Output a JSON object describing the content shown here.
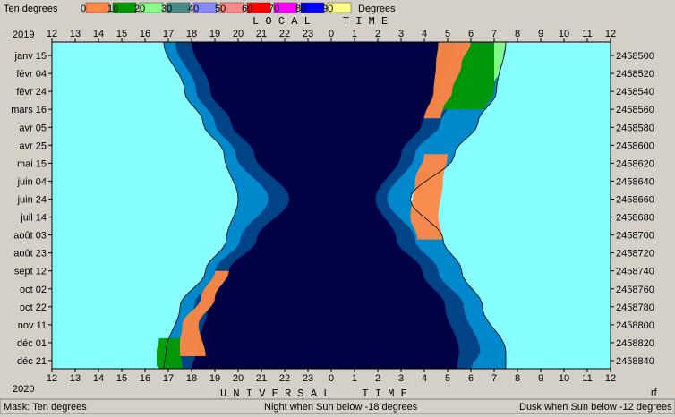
{
  "header": {
    "mask_label": "Ten degrees",
    "units_label": "Degrees",
    "year_top": "2019",
    "year_bottom": "2020",
    "local_time_label": "L O C A L     T I M E",
    "universal_time_label": "U N I V E R S A L     T I M E",
    "corner_mark": "rf"
  },
  "legend": {
    "labels": [
      "0",
      "10",
      "20",
      "30",
      "40",
      "50",
      "60",
      "70",
      "80",
      "90"
    ],
    "colors": [
      "#ff8844",
      "#009900",
      "#88ff88",
      "#448888",
      "#8888ff",
      "#ff8888",
      "#ff0000",
      "#ff00ff",
      "#0000ff",
      "#ffff88"
    ]
  },
  "status_bar": {
    "mask": "Mask:  Ten degrees",
    "night": "Night when Sun below -18 degrees",
    "dusk": "Dusk when Sun below -12 degrees"
  },
  "chart_data": {
    "type": "area",
    "local_time_ticks": [
      "12",
      "13",
      "14",
      "15",
      "16",
      "17",
      "18",
      "19",
      "20",
      "21",
      "22",
      "23",
      "0",
      "1",
      "2",
      "3",
      "4",
      "5",
      "6",
      "7",
      "8",
      "9",
      "10",
      "11",
      "12"
    ],
    "universal_time_ticks": [
      "12",
      "13",
      "14",
      "15",
      "16",
      "17",
      "18",
      "19",
      "20",
      "21",
      "22",
      "23",
      "0",
      "1",
      "2",
      "3",
      "4",
      "5",
      "6",
      "7",
      "8",
      "9",
      "10",
      "11",
      "12"
    ],
    "date_labels": [
      "janv 15",
      "févr 04",
      "févr 24",
      "mars 16",
      "avr 05",
      "avr 25",
      "mai 15",
      "juin 04",
      "juin 24",
      "juil 14",
      "août 03",
      "août 23",
      "sept 12",
      "oct 02",
      "oct 22",
      "nov 11",
      "déc 01",
      "déc 21"
    ],
    "jd_labels": [
      "2458500",
      "2458520",
      "2458540",
      "2458560",
      "2458580",
      "2458600",
      "2458620",
      "2458640",
      "2458660",
      "2458680",
      "2458700",
      "2458720",
      "2458740",
      "2458760",
      "2458780",
      "2458800",
      "2458820",
      "2458840"
    ],
    "jd_range": [
      2458485,
      2458849
    ],
    "time_range_hours": [
      12,
      36
    ],
    "colors": {
      "day": "#88ffff",
      "twilight_outer": "#0088cc",
      "twilight_inner": "#004488",
      "night": "#000044",
      "moon_low": "#ff8844",
      "moon_mid": "#009900",
      "moon_high": "#88ff88"
    },
    "boundaries": {
      "jd": [
        2458485,
        2458540,
        2458575,
        2458610,
        2458660,
        2458705,
        2458740,
        2458780,
        2458830,
        2458849
      ],
      "sunset": [
        16.8,
        17.7,
        18.5,
        19.4,
        20.0,
        19.5,
        18.6,
        17.5,
        16.9,
        16.8
      ],
      "dusk": [
        17.3,
        18.2,
        19.0,
        19.9,
        21.3,
        20.1,
        19.0,
        18.1,
        17.5,
        17.3
      ],
      "night_start": [
        18.0,
        18.8,
        19.7,
        20.7,
        22.2,
        20.8,
        19.6,
        18.7,
        18.2,
        18.0
      ],
      "night_end": [
        29.4,
        28.7,
        27.9,
        27.0,
        25.9,
        26.8,
        27.9,
        28.9,
        29.5,
        29.4
      ],
      "dawn": [
        30.0,
        29.5,
        28.7,
        27.6,
        26.4,
        27.6,
        28.6,
        29.7,
        30.4,
        30.0
      ],
      "sunrise": [
        31.5,
        31.1,
        30.3,
        29.3,
        27.4,
        28.8,
        29.6,
        30.5,
        31.5,
        31.5
      ]
    },
    "moon_bands": [
      {
        "band": "moon_low",
        "jd": [
          2458485,
          2458510,
          2458540,
          2458570
        ],
        "from": [
          28.6,
          28.5,
          28.4,
          28.0
        ],
        "to": [
          30.0,
          29.6,
          29.2,
          28.7
        ]
      },
      {
        "band": "moon_mid",
        "jd": [
          2458485,
          2458510,
          2458540,
          2458560
        ],
        "from": [
          30.0,
          29.6,
          29.2,
          28.8
        ],
        "to": [
          31.0,
          31.2,
          31.0,
          30.6
        ]
      },
      {
        "band": "moon_high",
        "jd": [
          2458485,
          2458500,
          2458520,
          2458530
        ],
        "from": [
          31.0,
          31.0,
          31.0,
          31.0
        ],
        "to": [
          31.5,
          31.4,
          31.2,
          31.0
        ]
      },
      {
        "band": "moon_low",
        "jd": [
          2458610,
          2458640,
          2458680,
          2458705
        ],
        "from": [
          28.0,
          27.6,
          27.4,
          27.7
        ],
        "to": [
          29.0,
          28.8,
          28.6,
          28.8
        ]
      },
      {
        "band": "moon_low",
        "jd": [
          2458740,
          2458770,
          2458800,
          2458835
        ],
        "from": [
          19.0,
          18.4,
          17.6,
          17.4
        ],
        "to": [
          19.6,
          19.0,
          18.3,
          18.6
        ]
      },
      {
        "band": "moon_mid",
        "jd": [
          2458815,
          2458830,
          2458845,
          2458849
        ],
        "from": [
          16.6,
          16.5,
          16.5,
          16.6
        ],
        "to": [
          17.5,
          17.5,
          17.6,
          17.6
        ]
      }
    ]
  }
}
